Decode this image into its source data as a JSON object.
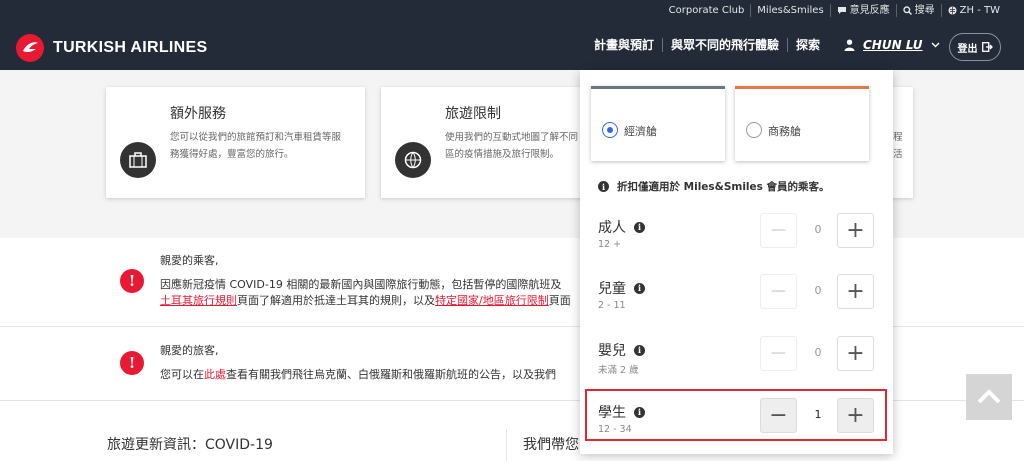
{
  "topbar": {
    "links": [
      {
        "label": "Corporate Club",
        "icon": ""
      },
      {
        "label": "Miles&Smiles",
        "icon": ""
      },
      {
        "label": "意見反應",
        "icon": "chat-bubble-icon"
      },
      {
        "label": "搜尋",
        "icon": "search-icon"
      },
      {
        "label": "ZH - TW",
        "icon": "globe-icon"
      }
    ]
  },
  "brand": {
    "name": "TURKISH AIRLINES",
    "color": "#e81932"
  },
  "nav": {
    "items": [
      "計畫與預訂",
      "與眾不同的飛行體驗",
      "探索"
    ],
    "user": "CHUN LU",
    "logout": "登出"
  },
  "cards": [
    {
      "title": "額外服務",
      "text_lines": [
        "您可以從我們的旅館預訂和汽車租賃等服",
        "務獲得好處，豐富您的旅行。"
      ],
      "icon": "suitcase-icon"
    },
    {
      "title": "旅遊限制",
      "text_lines": [
        "使用我們的互動式地圖了解不同",
        "區的疫情措施及旅行限制。"
      ],
      "icon": "globe-plane-icon"
    },
    {
      "title": "",
      "text_lines": [
        "程",
        "活"
      ],
      "icon": ""
    }
  ],
  "notices": [
    {
      "greeting": "親愛的乘客,",
      "line1": "因應新冠疫情 COVID-19 相關的最新國內與國際旅行動態，包括暫停的國際航班及",
      "line2_link1": "土耳其旅行規則",
      "line2_mid": "頁面了解適用於抵達土耳其的規則，以及",
      "line2_link2": "特定國家/地區旅行限制",
      "line2_end": "頁面"
    },
    {
      "greeting": "親愛的旅客,",
      "line1_pre": "您可以在",
      "line1_link": "此處",
      "line1_post": "查看有關我們飛往烏克蘭、白俄羅斯和俄羅斯航班的公告，以及我們"
    }
  ],
  "bottom": {
    "left_title": "旅遊更新資訊：COVID-19",
    "right_title": "我們帶您"
  },
  "panel": {
    "cabins": [
      {
        "label": "經濟艙",
        "selected": true,
        "accent": "#6b7685"
      },
      {
        "label": "商務艙",
        "selected": false,
        "accent": "#e07a4a"
      }
    ],
    "discount_note": "折扣僅適用於 Miles&Smiles 會員的乘客。",
    "passengers": [
      {
        "name": "成人",
        "age": "12 +",
        "count": "0"
      },
      {
        "name": "兒童",
        "age": "2 - 11",
        "count": "0"
      },
      {
        "name": "嬰兒",
        "age": "未滿 2 歲",
        "count": "0"
      },
      {
        "name": "學生",
        "age": "12 - 34",
        "count": "1"
      }
    ],
    "minus": "−",
    "plus": "+"
  }
}
